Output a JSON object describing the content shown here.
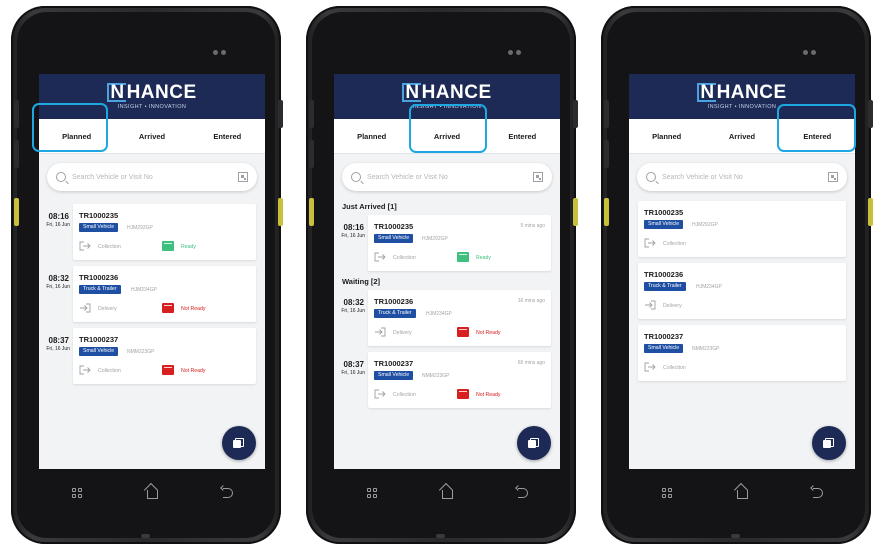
{
  "app": {
    "brand": "HANCE",
    "brand_initial": "N",
    "tagline": "INSIGHT • INNOVATION",
    "accent": "#1c2a55",
    "highlight": "#1ea7e1"
  },
  "tabs": {
    "planned": "Planned",
    "arrived": "Arrived",
    "entered": "Entered"
  },
  "search": {
    "placeholder": "Search Vehicle or Visit No"
  },
  "screens": {
    "planned": {
      "rows": [
        {
          "time": "08:16",
          "date": "Fri, 16 Jun",
          "id": "TR1000235",
          "vehicle": "Small Vehicle",
          "plate": "HJM292GP",
          "direction": "Collection",
          "status": "Ready"
        },
        {
          "time": "08:32",
          "date": "Fri, 16 Jun",
          "id": "TR1000236",
          "vehicle": "Truck & Trailer",
          "plate": "HJM234GP",
          "direction": "Delivery",
          "status": "Not Ready"
        },
        {
          "time": "08:37",
          "date": "Fri, 16 Jun",
          "id": "TR1000237",
          "vehicle": "Small Vehicle",
          "plate": "NMM223GP",
          "direction": "Collection",
          "status": "Not Ready"
        }
      ]
    },
    "arrived": {
      "section_just": "Just Arrived [1]",
      "section_waiting": "Waiting [2]",
      "rows": [
        {
          "time": "08:16",
          "date": "Fri, 16 Jun",
          "id": "TR1000235",
          "ago": "5 mins ago",
          "vehicle": "Small Vehicle",
          "plate": "HJM292GP",
          "direction": "Collection",
          "status": "Ready"
        },
        {
          "time": "08:32",
          "date": "Fri, 16 Jun",
          "id": "TR1000236",
          "ago": "16 mins ago",
          "vehicle": "Truck & Trailer",
          "plate": "HJM234GP",
          "direction": "Delivery",
          "status": "Not Ready"
        },
        {
          "time": "08:37",
          "date": "Fri, 16 Jun",
          "id": "TR1000237",
          "ago": "65 mins ago",
          "vehicle": "Small Vehicle",
          "plate": "NMM223GP",
          "direction": "Collection",
          "status": "Not Ready"
        }
      ]
    },
    "entered": {
      "rows": [
        {
          "id": "TR1000235",
          "vehicle": "Small Vehicle",
          "plate": "HJM292GP",
          "direction": "Collection"
        },
        {
          "id": "TR1000236",
          "vehicle": "Truck & Trailer",
          "plate": "HJM234GP",
          "direction": "Delivery"
        },
        {
          "id": "TR1000237",
          "vehicle": "Small Vehicle",
          "plate": "NMM223GP",
          "direction": "Collection"
        }
      ]
    }
  },
  "status_colors": {
    "ready": "#3fc07e",
    "not_ready": "#d82020",
    "vehicle_badge": "#1e4fa3"
  },
  "icons": {
    "search": "search-icon",
    "qr": "qr-code-icon",
    "fab": "add-visit-icon",
    "direction": "entry-arrow-icon",
    "status": "trailer-status-icon"
  }
}
